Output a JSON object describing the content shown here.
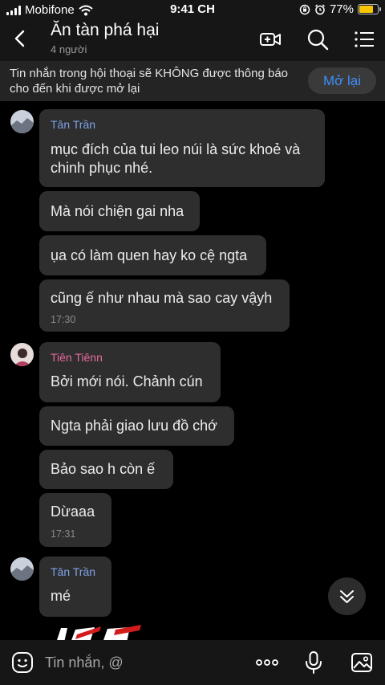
{
  "status_bar": {
    "carrier": "Mobifone",
    "time": "9:41 CH",
    "battery": "77%",
    "battery_level": 0.77
  },
  "header": {
    "title": "Ăn tàn phá hại",
    "members": "4 người"
  },
  "notice": {
    "text": "Tin nhắn trong hội thoại sẽ KHÔNG được thông báo cho đến khi được mở lại",
    "button": "Mở lại"
  },
  "messages": [
    {
      "sender": "Tân Trần",
      "lines": [
        "mục đích của tui leo núi là sức khoẻ và",
        "chinh phục nhé."
      ],
      "time": ""
    },
    {
      "sender": "",
      "lines": [
        "Mà nói chiện gai nha"
      ],
      "time": ""
    },
    {
      "sender": "",
      "lines": [
        "ụa có làm quen hay ko cệ ngta"
      ],
      "time": ""
    },
    {
      "sender": "",
      "lines": [
        "cũng ế như nhau mà sao cay vậyh"
      ],
      "time": "17:30"
    },
    {
      "sender": "Tiên Tiênn",
      "lines": [
        "Bởi mới nói. Chảnh cún"
      ],
      "time": ""
    },
    {
      "sender": "",
      "lines": [
        "Ngta phải giao lưu đồ chớ"
      ],
      "time": ""
    },
    {
      "sender": "",
      "lines": [
        "Bảo sao h còn ế"
      ],
      "time": ""
    },
    {
      "sender": "",
      "lines": [
        "Dừaaa"
      ],
      "time": "17:31"
    },
    {
      "sender": "Tân Trần",
      "lines": [
        "mé"
      ],
      "time": ""
    }
  ],
  "composer": {
    "placeholder": "Tin nhắn, @"
  },
  "colors": {
    "accent": "#3e8ef7",
    "bubble": "#2e2e2e",
    "sender_blue": "#7fa3e8",
    "sender_pink": "#e86aa0"
  }
}
